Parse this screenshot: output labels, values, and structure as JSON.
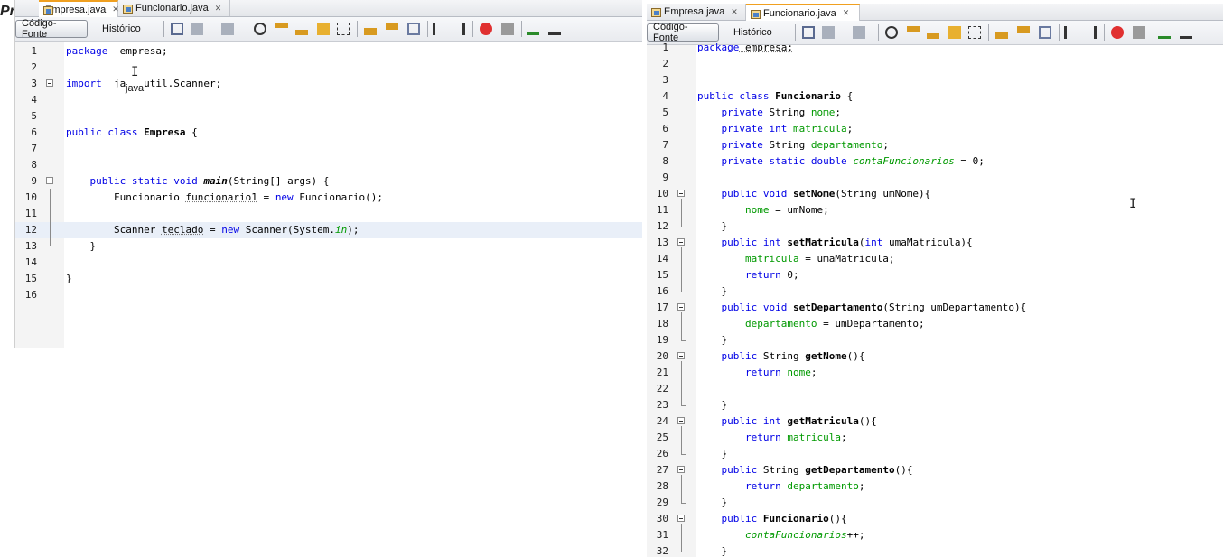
{
  "corner_text": "Pr",
  "colors": {
    "keyword": "#0000e6",
    "field": "#009900",
    "current_line": "#e9eff8",
    "tab_accent": "#f0a020"
  },
  "left": {
    "tabs": [
      {
        "label": "Empresa.java",
        "active": true
      },
      {
        "label": "Funcionario.java",
        "active": false
      }
    ],
    "views": {
      "source": "Código-Fonte",
      "history": "Histórico"
    },
    "tooltip": "java",
    "lines": [
      {
        "n": "1",
        "code": [
          [
            "kw",
            "package"
          ],
          [
            "",
            "  empresa;"
          ]
        ]
      },
      {
        "n": "2",
        "code": []
      },
      {
        "n": "3",
        "code": [
          [
            "kw",
            "import"
          ],
          [
            "",
            "  ja   util.Scanner;"
          ]
        ]
      },
      {
        "n": "4",
        "code": []
      },
      {
        "n": "5",
        "code": []
      },
      {
        "n": "6",
        "code": [
          [
            "kw",
            "public class"
          ],
          [
            "",
            " "
          ],
          [
            "bold",
            "Empresa"
          ],
          [
            "",
            " {"
          ]
        ]
      },
      {
        "n": "7",
        "code": []
      },
      {
        "n": "8",
        "code": []
      },
      {
        "n": "9",
        "code": [
          [
            "",
            "    "
          ],
          [
            "kw",
            "public static void"
          ],
          [
            "",
            " "
          ],
          [
            "it",
            "main"
          ],
          [
            "",
            "(String[] args) {"
          ]
        ]
      },
      {
        "n": "10",
        "code": [
          [
            "",
            "        Funcionario "
          ],
          [
            "und",
            "funcionario1"
          ],
          [
            "",
            " = "
          ],
          [
            "kw",
            "new"
          ],
          [
            "",
            " Funcionario();"
          ]
        ]
      },
      {
        "n": "11",
        "code": []
      },
      {
        "n": "12",
        "code": [
          [
            "",
            "        Scanner "
          ],
          [
            "und",
            "teclado"
          ],
          [
            "",
            " = "
          ],
          [
            "kw",
            "new"
          ],
          [
            "",
            " Scanner(System."
          ],
          [
            "sfld",
            "in"
          ],
          [
            "",
            ");"
          ]
        ]
      },
      {
        "n": "13",
        "code": [
          [
            "",
            "    }"
          ]
        ]
      },
      {
        "n": "14",
        "code": []
      },
      {
        "n": "15",
        "code": [
          [
            "",
            "}"
          ]
        ]
      },
      {
        "n": "16",
        "code": []
      }
    ]
  },
  "right": {
    "tabs": [
      {
        "label": "Empresa.java",
        "active": false
      },
      {
        "label": "Funcionario.java",
        "active": true
      }
    ],
    "views": {
      "source": "Código-Fonte",
      "history": "Histórico"
    },
    "lines": [
      {
        "n": "1",
        "code": [
          [
            "kw",
            "package"
          ],
          [
            "",
            ""
          ],
          [
            "und",
            " empresa;"
          ]
        ]
      },
      {
        "n": "2",
        "code": []
      },
      {
        "n": "3",
        "code": []
      },
      {
        "n": "4",
        "code": [
          [
            "kw",
            "public class"
          ],
          [
            "",
            " "
          ],
          [
            "bold",
            "Funcionario"
          ],
          [
            "",
            " {"
          ]
        ]
      },
      {
        "n": "5",
        "code": [
          [
            "",
            "    "
          ],
          [
            "kw",
            "private"
          ],
          [
            "",
            " String "
          ],
          [
            "fld",
            "nome"
          ],
          [
            "",
            ";"
          ]
        ]
      },
      {
        "n": "6",
        "code": [
          [
            "",
            "    "
          ],
          [
            "kw",
            "private int"
          ],
          [
            "",
            " "
          ],
          [
            "fld",
            "matricula"
          ],
          [
            "",
            ";"
          ]
        ]
      },
      {
        "n": "7",
        "code": [
          [
            "",
            "    "
          ],
          [
            "kw",
            "private"
          ],
          [
            "",
            " String "
          ],
          [
            "fld",
            "departamento"
          ],
          [
            "",
            ";"
          ]
        ]
      },
      {
        "n": "8",
        "code": [
          [
            "",
            "    "
          ],
          [
            "kw",
            "private static double"
          ],
          [
            "",
            " "
          ],
          [
            "sfld",
            "contaFuncionarios"
          ],
          [
            "",
            " = 0;"
          ]
        ]
      },
      {
        "n": "9",
        "code": []
      },
      {
        "n": "10",
        "code": [
          [
            "",
            "    "
          ],
          [
            "kw",
            "public void"
          ],
          [
            "",
            " "
          ],
          [
            "bold",
            "setNome"
          ],
          [
            "",
            "(String umNome){"
          ]
        ]
      },
      {
        "n": "11",
        "code": [
          [
            "",
            "        "
          ],
          [
            "fld",
            "nome"
          ],
          [
            "",
            " = umNome;"
          ]
        ]
      },
      {
        "n": "12",
        "code": [
          [
            "",
            "    }"
          ]
        ]
      },
      {
        "n": "13",
        "code": [
          [
            "",
            "    "
          ],
          [
            "kw",
            "public int"
          ],
          [
            "",
            " "
          ],
          [
            "bold",
            "setMatricula"
          ],
          [
            "",
            "("
          ],
          [
            "kw",
            "int"
          ],
          [
            "",
            " umaMatricula){"
          ]
        ]
      },
      {
        "n": "14",
        "code": [
          [
            "",
            "        "
          ],
          [
            "fld",
            "matricula"
          ],
          [
            "",
            " = umaMatricula;"
          ]
        ]
      },
      {
        "n": "15",
        "code": [
          [
            "",
            "        "
          ],
          [
            "kw",
            "return"
          ],
          [
            "",
            " 0;"
          ]
        ]
      },
      {
        "n": "16",
        "code": [
          [
            "",
            "    }"
          ]
        ]
      },
      {
        "n": "17",
        "code": [
          [
            "",
            "    "
          ],
          [
            "kw",
            "public void"
          ],
          [
            "",
            " "
          ],
          [
            "bold",
            "setDepartamento"
          ],
          [
            "",
            "(String umDepartamento){"
          ]
        ]
      },
      {
        "n": "18",
        "code": [
          [
            "",
            "        "
          ],
          [
            "fld",
            "departamento"
          ],
          [
            "",
            " = umDepartamento;"
          ]
        ]
      },
      {
        "n": "19",
        "code": [
          [
            "",
            "    }"
          ]
        ]
      },
      {
        "n": "20",
        "code": [
          [
            "",
            "    "
          ],
          [
            "kw",
            "public"
          ],
          [
            "",
            " String "
          ],
          [
            "bold",
            "getNome"
          ],
          [
            "",
            "(){"
          ]
        ]
      },
      {
        "n": "21",
        "code": [
          [
            "",
            "        "
          ],
          [
            "kw",
            "return"
          ],
          [
            "",
            " "
          ],
          [
            "fld",
            "nome"
          ],
          [
            "",
            ";"
          ]
        ]
      },
      {
        "n": "22",
        "code": []
      },
      {
        "n": "23",
        "code": [
          [
            "",
            "    }"
          ]
        ]
      },
      {
        "n": "24",
        "code": [
          [
            "",
            "    "
          ],
          [
            "kw",
            "public int"
          ],
          [
            "",
            " "
          ],
          [
            "bold",
            "getMatricula"
          ],
          [
            "",
            "(){"
          ]
        ]
      },
      {
        "n": "25",
        "code": [
          [
            "",
            "        "
          ],
          [
            "kw",
            "return"
          ],
          [
            "",
            " "
          ],
          [
            "fld",
            "matricula"
          ],
          [
            "",
            ";"
          ]
        ]
      },
      {
        "n": "26",
        "code": [
          [
            "",
            "    }"
          ]
        ]
      },
      {
        "n": "27",
        "code": [
          [
            "",
            "    "
          ],
          [
            "kw",
            "public"
          ],
          [
            "",
            " String "
          ],
          [
            "bold",
            "getDepartamento"
          ],
          [
            "",
            "(){"
          ]
        ]
      },
      {
        "n": "28",
        "code": [
          [
            "",
            "        "
          ],
          [
            "kw",
            "return"
          ],
          [
            "",
            " "
          ],
          [
            "fld",
            "departamento"
          ],
          [
            "",
            ";"
          ]
        ]
      },
      {
        "n": "29",
        "code": [
          [
            "",
            "    }"
          ]
        ]
      },
      {
        "n": "30",
        "code": [
          [
            "",
            "    "
          ],
          [
            "kw",
            "public"
          ],
          [
            "",
            " "
          ],
          [
            "bold",
            "Funcionario"
          ],
          [
            "",
            "(){"
          ]
        ]
      },
      {
        "n": "31",
        "code": [
          [
            "",
            "        "
          ],
          [
            "sfld",
            "contaFuncionarios"
          ],
          [
            "",
            "++;"
          ]
        ]
      },
      {
        "n": "32",
        "code": [
          [
            "",
            "    }"
          ]
        ]
      }
    ]
  }
}
